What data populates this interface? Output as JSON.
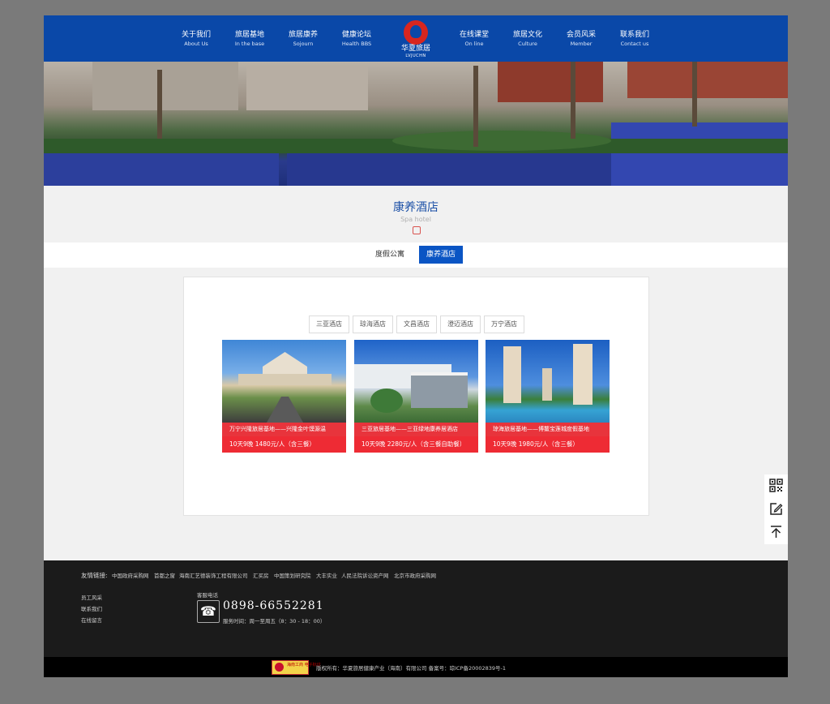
{
  "nav": {
    "left": [
      {
        "cn": "关于我们",
        "en": "About Us"
      },
      {
        "cn": "旅居基地",
        "en": "In the base"
      },
      {
        "cn": "旅居康养",
        "en": "Sojourn"
      },
      {
        "cn": "健康论坛",
        "en": "Health BBS"
      }
    ],
    "right": [
      {
        "cn": "在线课堂",
        "en": "On line"
      },
      {
        "cn": "旅居文化",
        "en": "Culture"
      },
      {
        "cn": "会员风采",
        "en": "Member"
      },
      {
        "cn": "联系我们",
        "en": "Contact us"
      }
    ],
    "logo_name": "华夏旅居",
    "logo_sub": "LVJUCHN"
  },
  "page": {
    "title": "康养酒店",
    "subtitle": "Spa hotel"
  },
  "tabs": [
    {
      "label": "度假公寓",
      "active": false
    },
    {
      "label": "康养酒店",
      "active": true
    }
  ],
  "filters": [
    "三亚酒店",
    "琼海酒店",
    "文昌酒店",
    "澄迈酒店",
    "万宁酒店"
  ],
  "cards": [
    {
      "title": "万宁兴隆旅居基地——兴隆金叶馍源温",
      "price": "10天9晚 1480元/人（含三餐）"
    },
    {
      "title": "三亚旅居基地——三亚绿地康养居酒店",
      "price": "10天9晚 2280元/人（含三餐自助餐）"
    },
    {
      "title": "琼海旅居基地——博鳌宝莲城度假基地",
      "price": "10天9晚 1980元/人（含三餐）"
    }
  ],
  "footer": {
    "links_label": "友情链接:",
    "friend_links": [
      "中国政府采购网",
      "首都之窗",
      "海南汇艺德装饰工程有限公司",
      "汇买房",
      "中国策划研究院",
      "大丰实业",
      "人民法院诉讼资产网",
      "北京市政府采购网"
    ],
    "nav": [
      "员工风采",
      "联系我们",
      "在线留言"
    ],
    "service_label": "客服电话",
    "phone": "0898-66552281",
    "hours": "服务时间：周一至周五（8：30 - 18：00）",
    "badge": "海南工商 电子标识",
    "copyright": "版权所有：华夏旅居健康产业（海南）有限公司 备案号：琼ICP备20002839号-1"
  },
  "icons": [
    "qr-code-icon",
    "edit-icon",
    "back-to-top-icon",
    "phone-icon"
  ],
  "colors": {
    "header": "#0a48a8",
    "accent": "#0a55c4",
    "card_caption": "#e8343c",
    "footer": "#1b1b1b"
  }
}
